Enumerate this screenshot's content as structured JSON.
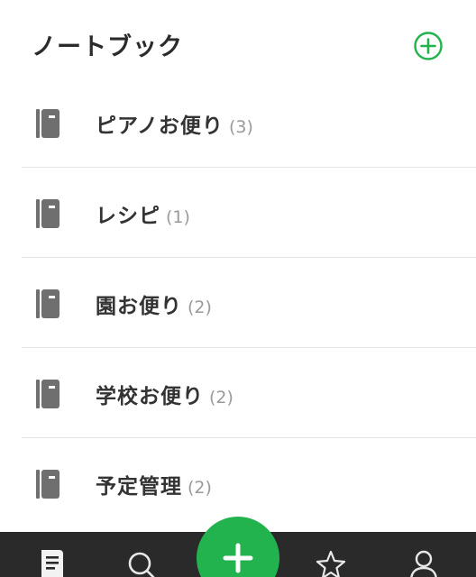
{
  "header": {
    "title": "ノートブック"
  },
  "notebooks": [
    {
      "name": "ピアノお便り",
      "count": "(3)"
    },
    {
      "name": "レシピ",
      "count": "(1)"
    },
    {
      "name": "園お便り",
      "count": "(2)"
    },
    {
      "name": "学校お便り",
      "count": "(2)"
    },
    {
      "name": "予定管理",
      "count": "(2)"
    }
  ],
  "tabbar": {
    "tabs": [
      {
        "icon": "notes-icon",
        "active": true
      },
      {
        "icon": "search-icon",
        "active": false
      },
      {
        "icon": "add-icon",
        "active": false
      },
      {
        "icon": "star-icon",
        "active": false
      },
      {
        "icon": "account-icon",
        "active": false
      }
    ]
  },
  "colors": {
    "accent": "#22b34f",
    "tabbar_bg": "#2a2a2a",
    "notebook_icon": "#6f6f6f",
    "text": "#333333",
    "count_text": "#9a9a9a",
    "divider": "#e4e4e4"
  }
}
